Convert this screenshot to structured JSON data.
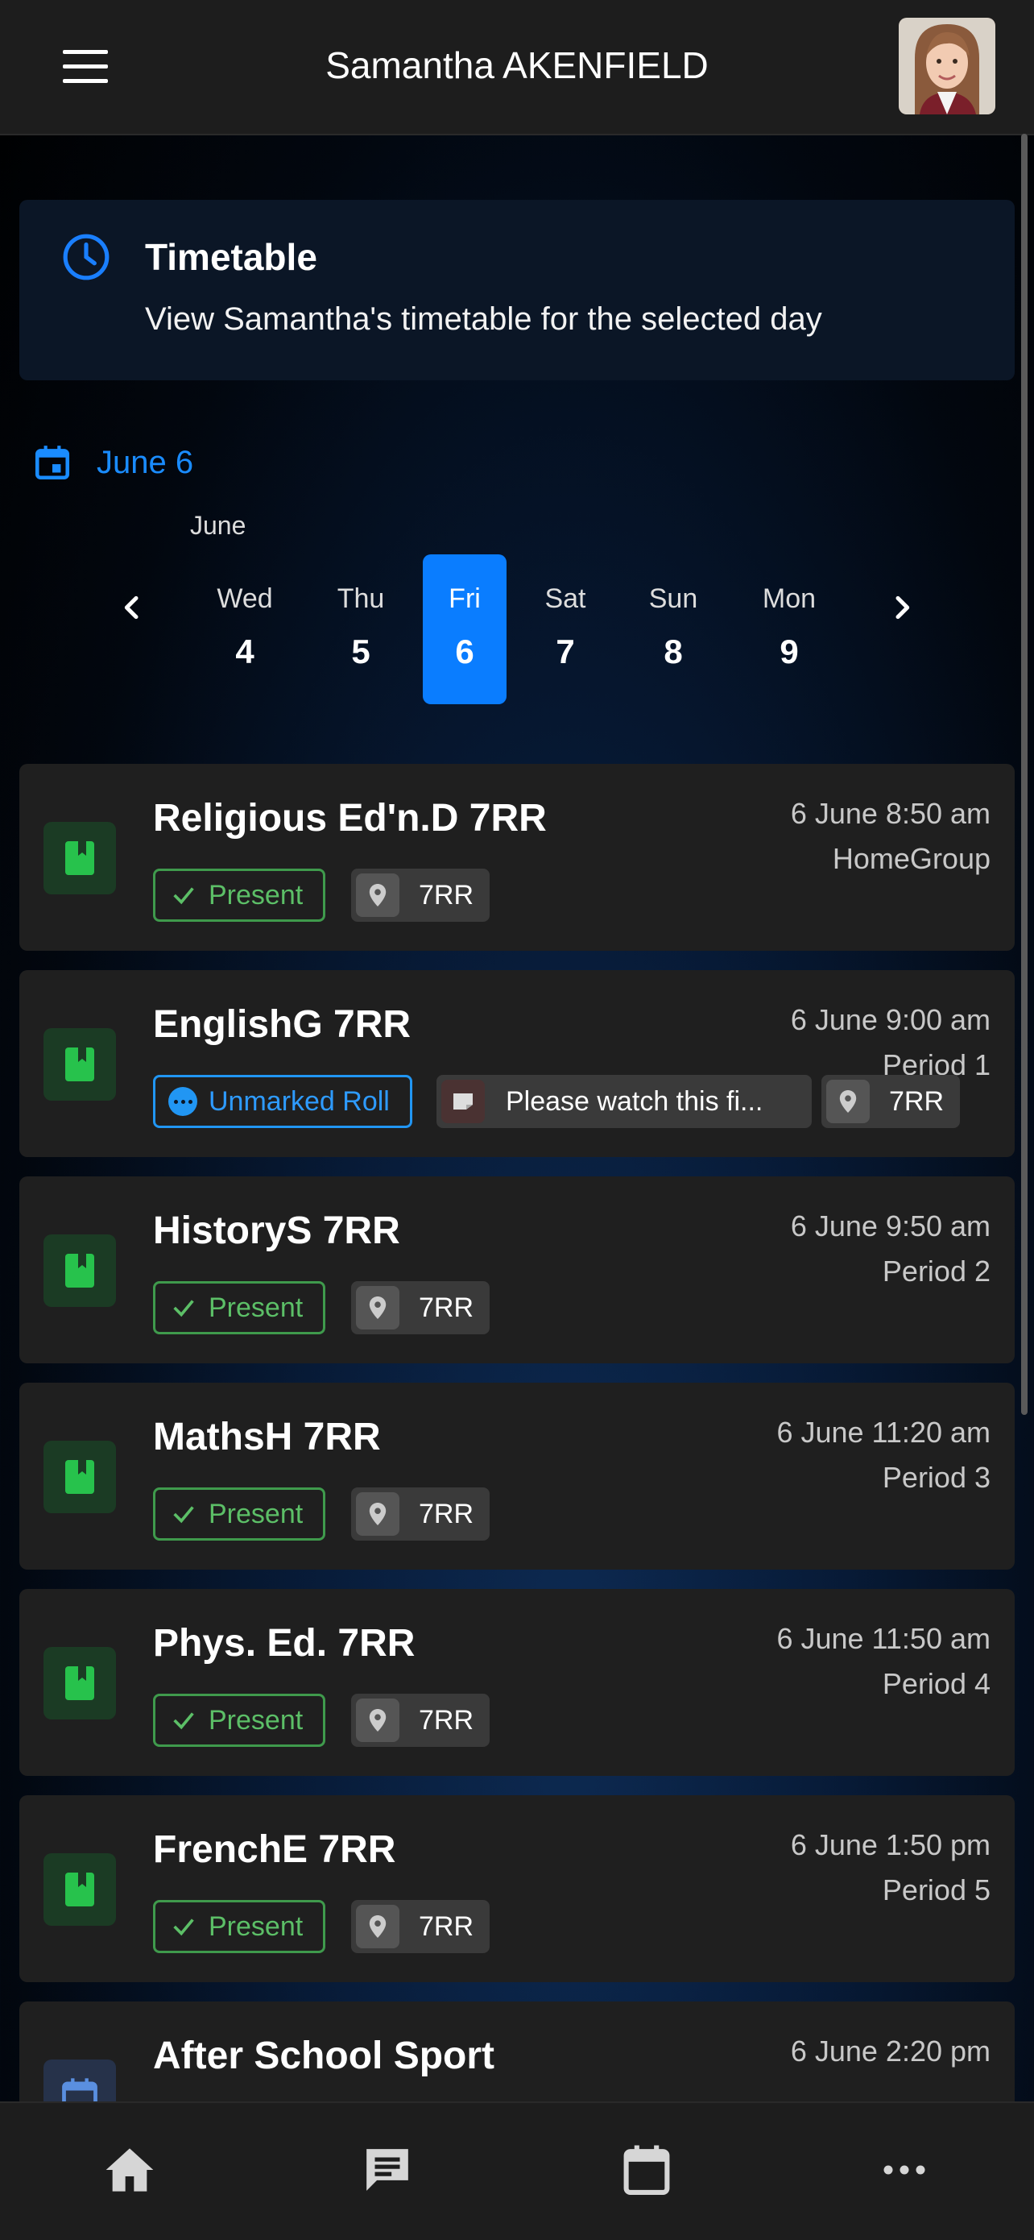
{
  "header": {
    "title": "Samantha AKENFIELD",
    "menu_icon": "hamburger-menu-icon",
    "avatar": "student-avatar"
  },
  "banner": {
    "title": "Timetable",
    "subtitle": "View Samantha's timetable for the selected day",
    "icon": "clock-icon"
  },
  "date_picker": {
    "selected_label": "June 6",
    "month": "June",
    "days": [
      {
        "name": "Wed",
        "date": "4"
      },
      {
        "name": "Thu",
        "date": "5"
      },
      {
        "name": "Fri",
        "date": "6",
        "selected": true
      },
      {
        "name": "Sat",
        "date": "7"
      },
      {
        "name": "Sun",
        "date": "8"
      },
      {
        "name": "Mon",
        "date": "9"
      }
    ]
  },
  "classes": [
    {
      "subject": "Religious Ed'n.D 7RR",
      "time": "6 June 8:50 am",
      "period": "HomeGroup",
      "status": "Present",
      "room": "7RR",
      "icon": "book-icon"
    },
    {
      "subject": "EnglishG 7RR",
      "time": "6 June 9:00 am",
      "period": "Period 1",
      "status": "Unmarked Roll",
      "note": "Please watch this fi...",
      "room": "7RR",
      "icon": "book-icon"
    },
    {
      "subject": "HistoryS 7RR",
      "time": "6 June 9:50 am",
      "period": "Period 2",
      "status": "Present",
      "room": "7RR",
      "icon": "book-icon"
    },
    {
      "subject": "MathsH 7RR",
      "time": "6 June 11:20 am",
      "period": "Period 3",
      "status": "Present",
      "room": "7RR",
      "icon": "book-icon"
    },
    {
      "subject": "Phys. Ed. 7RR",
      "time": "6 June 11:50 am",
      "period": "Period 4",
      "status": "Present",
      "room": "7RR",
      "icon": "book-icon"
    },
    {
      "subject": "FrenchE 7RR",
      "time": "6 June 1:50 pm",
      "period": "Period 5",
      "status": "Present",
      "room": "7RR",
      "icon": "book-icon"
    },
    {
      "subject": "After School Sport",
      "time": "6 June 2:20 pm",
      "icon": "calendar-icon"
    }
  ],
  "bottom_nav": [
    {
      "name": "home",
      "icon": "home-icon"
    },
    {
      "name": "messages",
      "icon": "message-icon"
    },
    {
      "name": "calendar",
      "icon": "calendar-icon"
    },
    {
      "name": "more",
      "icon": "more-icon"
    }
  ],
  "colors": {
    "accent": "#0A7DFF",
    "present": "#5CBF67",
    "unmarked": "#2196F3",
    "card": "#1F1F1F",
    "bar": "#1D1D1D"
  }
}
